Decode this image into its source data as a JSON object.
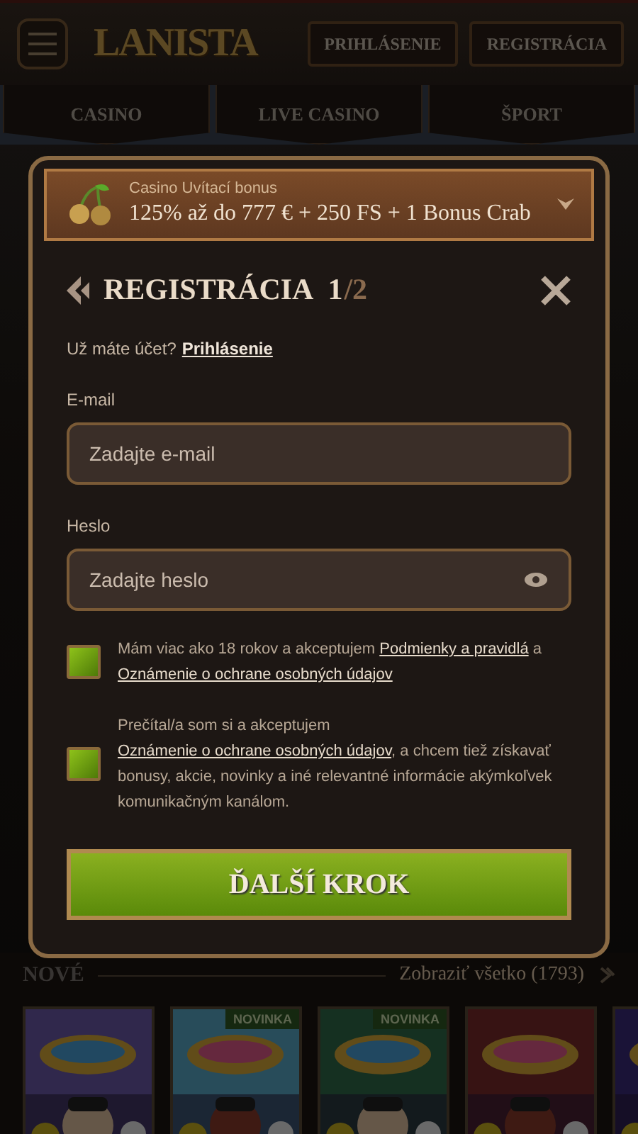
{
  "header": {
    "logo": "LANISTA",
    "buttons": [
      "PRIHLÁSENIE",
      "REGISTRÁCIA"
    ]
  },
  "nav": {
    "tabs": [
      {
        "label": "CASINO",
        "selected": false
      },
      {
        "label": "LIVE CASINO",
        "selected": false
      },
      {
        "label": "ŠPORT",
        "selected": false
      }
    ]
  },
  "modal": {
    "bonus": {
      "caption": "Casino Uvítací bonus",
      "offer": "125% až do 777 € + 250 FS + 1 Bonus Crab",
      "expanded": false
    },
    "title": "REGISTRÁCIA",
    "step": "1",
    "step_total": "/2",
    "account_prompt": "Už máte účet?",
    "login_link": "Prihlásenie",
    "fields": [
      {
        "label": "E-mail",
        "placeholder": "Zadajte e-mail",
        "kind": "email"
      },
      {
        "label": "Heslo",
        "placeholder": "Zadajte heslo",
        "kind": "password"
      }
    ],
    "consents": [
      {
        "checked": true,
        "parts": [
          {
            "kind": "text",
            "text": "Mám viac ako 18 rokov a akceptujem "
          },
          {
            "kind": "link",
            "text": "Podmienky a pravidlá"
          },
          {
            "kind": "text",
            "text": " a "
          },
          {
            "kind": "link",
            "text": "Oznámenie o ochrane osobných údajov"
          }
        ]
      },
      {
        "checked": true,
        "parts": [
          {
            "kind": "text",
            "text": "Prečítal/a som si a akceptujem "
          },
          {
            "kind": "link",
            "text": "Oznámenie o ochrane osobných údajov"
          },
          {
            "kind": "text",
            "text": ", a chcem tiež získavať bonusy, akcie, novinky a iné relevantné informácie akýmkoľvek komunikačným kanálom."
          }
        ]
      }
    ],
    "submit": "ĎALŠÍ KROK"
  },
  "section": {
    "title": "NOVÉ",
    "view_all": "Zobraziť všetko (1793)",
    "games": [
      {
        "kind": "picture"
      },
      {
        "kind": "picture",
        "badge": "NOVINKA"
      },
      {
        "kind": "picture",
        "badge": "NOVINKA"
      },
      {
        "kind": "picture"
      },
      {
        "kind": "picture"
      }
    ]
  }
}
